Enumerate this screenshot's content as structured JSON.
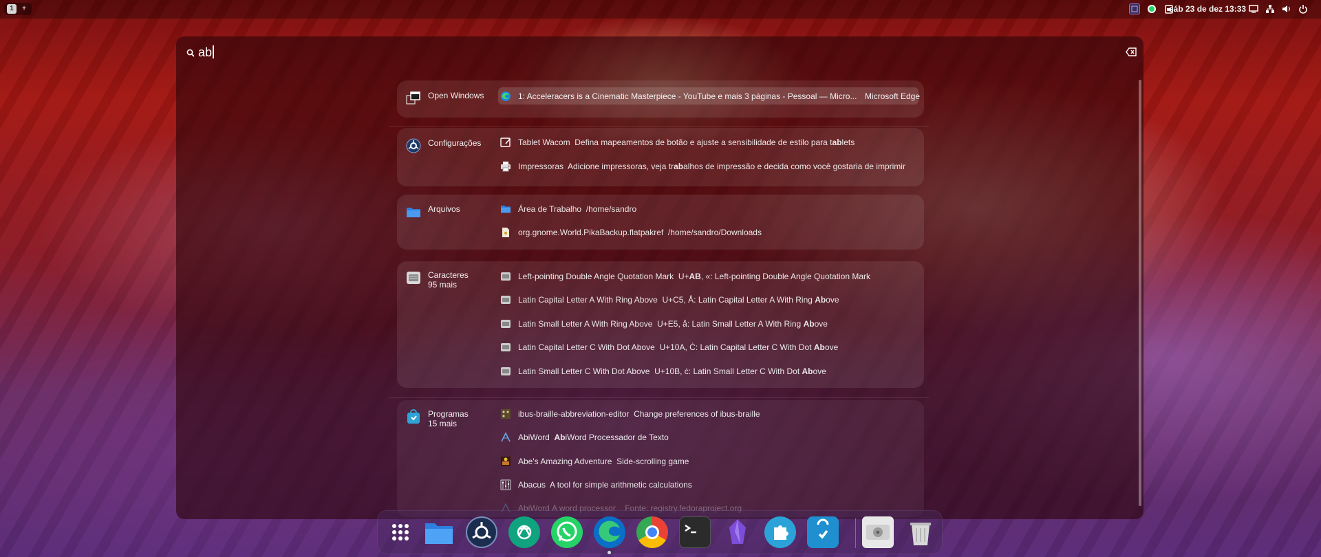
{
  "topbar": {
    "workspaces": [
      "1",
      "+"
    ],
    "clock": "sáb 23 de dez  13:33",
    "tray_left_icons": [
      "app-indicator-icon",
      "whatsapp-icon",
      "clipboard-icon"
    ],
    "tray_right_icons": [
      "display-icon",
      "network-icon",
      "volume-icon",
      "power-icon"
    ]
  },
  "search": {
    "query": "ab",
    "icons": [
      "search-icon",
      "clear-icon"
    ]
  },
  "groups": {
    "open_windows": {
      "label": "Open Windows",
      "icon": "window-icon",
      "items": [
        {
          "title": "1: Acceleracers is a Cinematic Masterpiece - YouTube e mais 3 páginas - Pessoal — Micro...",
          "app": "Microsoft Edge",
          "icon": "edge-icon"
        }
      ]
    },
    "settings": {
      "label": "Configurações",
      "icon": "settings-icon",
      "items": [
        {
          "name": "Tablet Wacom",
          "desc_pre": "Defina mapeamentos de botão e ajuste a sensibilidade de estilo para t",
          "desc_hl": "ab",
          "desc_post": "lets",
          "icon": "tablet-icon"
        },
        {
          "name": "Impressoras",
          "desc_pre": "Adicione impressoras, veja tr",
          "desc_hl": "ab",
          "desc_post": "alhos de impressão e decida como você gostaria de imprimir",
          "icon": "printer-icon"
        }
      ]
    },
    "files": {
      "label": "Arquivos",
      "icon": "folder-icon",
      "items": [
        {
          "name": "Área de Trabalho",
          "desc": "/home/sandro",
          "icon": "folder-icon"
        },
        {
          "name": "org.gnome.World.PikaBackup.flatpakref",
          "desc": "/home/sandro/Downloads",
          "icon": "file-icon"
        }
      ]
    },
    "characters": {
      "label": "Caracteres",
      "more": "95 mais",
      "icon": "keyboard-icon",
      "items": [
        {
          "name": "Left-pointing Double Angle Quotation Mark",
          "desc_pre": "U+",
          "desc_hl": "AB",
          "desc_post": ", «: Left-pointing Double Angle Quotation Mark"
        },
        {
          "name": "Latin Capital Letter A With Ring Above",
          "desc_pre": "U+C5, Å: Latin Capital Letter A With Ring ",
          "desc_hl": "Ab",
          "desc_post": "ove"
        },
        {
          "name": "Latin Small Letter A With Ring Above",
          "desc_pre": "U+E5, å: Latin Small Letter A With Ring ",
          "desc_hl": "Ab",
          "desc_post": "ove"
        },
        {
          "name": "Latin Capital Letter C With Dot Above",
          "desc_pre": "U+10A, Ċ: Latin Capital Letter C With Dot ",
          "desc_hl": "Ab",
          "desc_post": "ove"
        },
        {
          "name": "Latin Small Letter C With Dot Above",
          "desc_pre": "U+10B, ċ: Latin Small Letter C With Dot ",
          "desc_hl": "Ab",
          "desc_post": "ove"
        }
      ]
    },
    "programs": {
      "label": "Programas",
      "more": "15 mais",
      "icon": "software-icon",
      "items": [
        {
          "name": "ibus-braille-abbreviation-editor",
          "desc_pre": "Change preferences of ibus-braille",
          "desc_hl": "",
          "desc_post": "",
          "icon": "braille-icon"
        },
        {
          "name": "AbiWord",
          "desc_pre": "",
          "desc_hl": "Ab",
          "desc_post": "iWord Processador de Texto",
          "icon": "abiword-icon"
        },
        {
          "name": "Abe's Amazing Adventure",
          "desc_pre": "Side-scrolling game",
          "desc_hl": "",
          "desc_post": "",
          "icon": "game-icon"
        },
        {
          "name": "Abacus",
          "desc_pre": "A tool for simple arithmetic calculations",
          "desc_hl": "",
          "desc_post": "",
          "icon": "abacus-icon"
        },
        {
          "name": "AbiWord",
          "desc_pre": "A word processor",
          "desc_hl": "",
          "desc_post": "Fonte: registry.fedoraproject.org",
          "icon": "abiword-icon"
        }
      ]
    }
  },
  "dock": {
    "apps": [
      "app-grid",
      "files",
      "settings",
      "chatgpt",
      "whatsapp",
      "edge",
      "chrome",
      "terminal",
      "obsidian",
      "extensions",
      "software",
      "disk",
      "trash"
    ]
  },
  "colors": {
    "accent_blue": "#3584e4",
    "highlight": "#ffffff"
  }
}
